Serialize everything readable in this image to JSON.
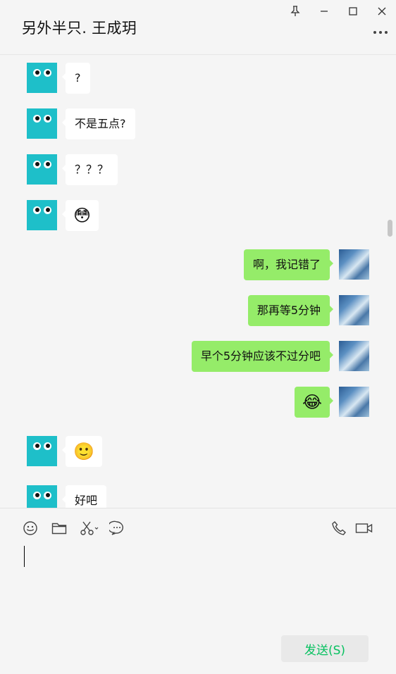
{
  "window": {
    "title": "另外半只. 王成玥",
    "controls": [
      "pin-icon",
      "minimize-icon",
      "maximize-icon",
      "close-icon"
    ]
  },
  "messages": [
    {
      "side": "left",
      "text": "?"
    },
    {
      "side": "left",
      "text": "不是五点?"
    },
    {
      "side": "left",
      "text": "？？？"
    },
    {
      "side": "left",
      "text": "😳"
    },
    {
      "side": "right",
      "text": "啊，我记错了"
    },
    {
      "side": "right",
      "text": "那再等5分钟"
    },
    {
      "side": "right",
      "text": "早个5分钟应该不过分吧"
    },
    {
      "side": "right",
      "text": "😂"
    },
    {
      "side": "left",
      "text": "🙂"
    },
    {
      "side": "left",
      "text": "好吧"
    }
  ],
  "toolbar": {
    "left_tools": [
      "emoji-icon",
      "folder-icon",
      "scissors-icon",
      "chat-history-icon"
    ],
    "right_tools": [
      "voice-call-icon",
      "video-call-icon"
    ]
  },
  "input": {
    "value": ""
  },
  "send_button": {
    "label": "发送(S)",
    "label_color": "#07c160"
  },
  "colors": {
    "outgoing_bubble": "#95ec69",
    "incoming_bubble": "#ffffff",
    "avatar_left": "#1ebfc9"
  }
}
